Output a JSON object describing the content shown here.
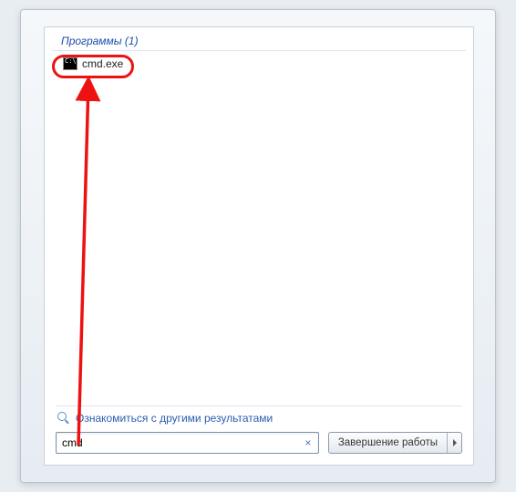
{
  "section": {
    "programs_label": "Программы (1)"
  },
  "results": {
    "item0": {
      "label": "cmd.exe",
      "icon": "cmd-icon"
    }
  },
  "more_results": {
    "label": "Ознакомиться с другими результатами"
  },
  "search": {
    "value": "cmd",
    "clear": "×"
  },
  "shutdown": {
    "label": "Завершение работы"
  },
  "annotation": {
    "color": "#e11"
  }
}
